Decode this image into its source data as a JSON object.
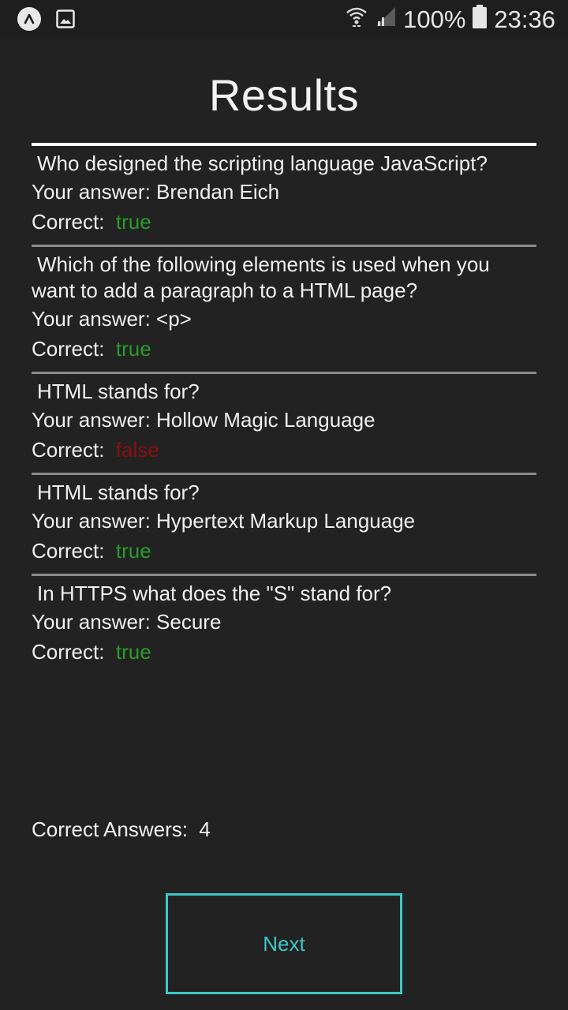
{
  "status_bar": {
    "battery": "100%",
    "time": "23:36",
    "icons": [
      "app-circle-icon",
      "gallery-icon",
      "wifi-icon",
      "signal-icon",
      "battery-icon"
    ]
  },
  "page": {
    "title": "Results"
  },
  "results": [
    {
      "question": "Who designed the scripting language JavaScript?",
      "answer_label": "Your answer: ",
      "answer": "Brendan Eich",
      "correct_label": "Correct:  ",
      "correct": "true"
    },
    {
      "question": "Which of the following elements is used when you want to add a paragraph to a HTML page?",
      "answer_label": "Your answer: ",
      "answer": "<p>",
      "correct_label": "Correct:  ",
      "correct": "true"
    },
    {
      "question": "HTML stands for?",
      "answer_label": "Your answer: ",
      "answer": "Hollow Magic Language",
      "correct_label": "Correct:  ",
      "correct": "false"
    },
    {
      "question": "HTML stands for?",
      "answer_label": "Your answer: ",
      "answer": "Hypertext Markup Language",
      "correct_label": "Correct:  ",
      "correct": "true"
    },
    {
      "question": "In HTTPS what does the \"S\" stand for?",
      "answer_label": "Your answer: ",
      "answer": "Secure",
      "correct_label": "Correct:  ",
      "correct": "true"
    }
  ],
  "summary": {
    "label": "Correct Answers:  ",
    "value": "4"
  },
  "actions": {
    "next_label": "Next"
  },
  "colors": {
    "background": "#222222",
    "correct_true": "#2a9a2a",
    "correct_false": "#8a0f0f",
    "accent": "#3cc7c7"
  }
}
